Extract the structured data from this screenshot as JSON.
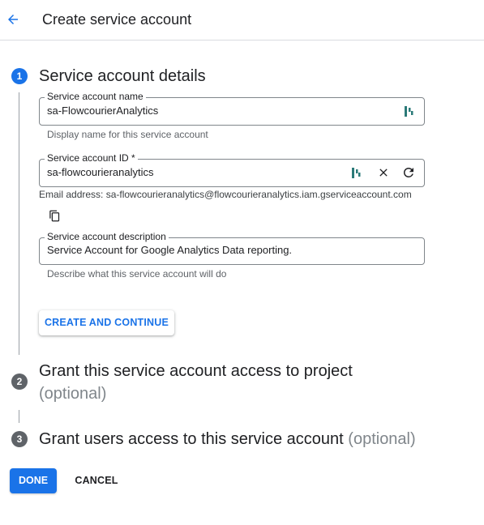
{
  "header": {
    "title": "Create service account",
    "back_icon": "arrow-back-icon"
  },
  "steps": [
    {
      "number": "1",
      "title": "Service account details",
      "state": "active"
    },
    {
      "number": "2",
      "title": "Grant this service account access to project",
      "optional": "(optional)",
      "state": "inactive"
    },
    {
      "number": "3",
      "title": "Grant users access to this service account",
      "optional": "(optional)",
      "state": "inactive"
    }
  ],
  "form": {
    "name": {
      "label": "Service account name",
      "value": "sa-FlowcourierAnalytics",
      "hint": "Display name for this service account"
    },
    "id": {
      "label": "Service account ID *",
      "value": "sa-flowcourieranalytics",
      "email": "Email address: sa-flowcourieranalytics@flowcourieranalytics.iam.gserviceaccount.com"
    },
    "description": {
      "label": "Service account description",
      "value": "Service Account for Google Analytics Data reporting.",
      "hint": "Describe what this service account will do"
    }
  },
  "buttons": {
    "create_continue": "CREATE AND CONTINUE",
    "done": "DONE",
    "cancel": "CANCEL"
  },
  "colors": {
    "primary": "#1a73e8",
    "step_inactive": "#5f6368",
    "extension_icon": "#2b7a78"
  }
}
